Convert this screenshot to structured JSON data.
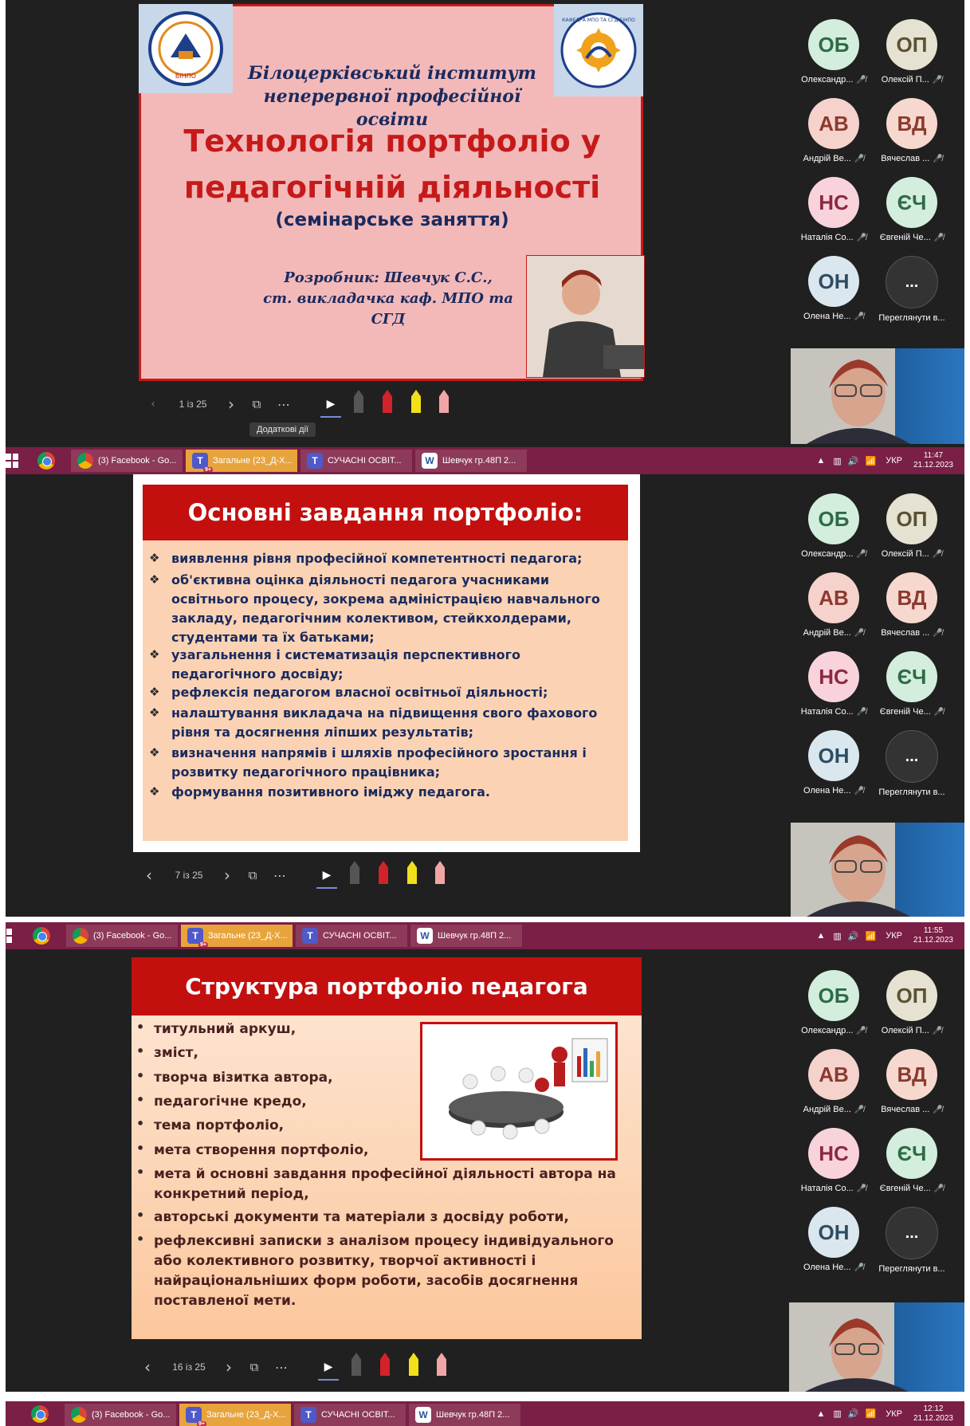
{
  "screens": [
    {
      "slide": {
        "institute": "Білоцерківський інститут\nнеперервної професійної освіти",
        "title": "Технологія  портфоліо у\nпедагогічній діяльності",
        "subtitle": "(семінарське заняття)",
        "author": "Розробник: Шевчук С.С.,\nст. викладачка каф. МПО та СГД",
        "logo_left_text": "БІНПО",
        "logo_right_text": "КАФЕДРА МПО ТА СГД БІНПО"
      },
      "controls": {
        "page": "1 із 25",
        "tooltip": "Додаткові дії"
      },
      "tray": {
        "lang": "УКР",
        "time": "11:47",
        "date": "21.12.2023"
      }
    },
    {
      "slide": {
        "title": "Основні завдання  портфоліо:",
        "items": [
          "виявлення рівня професійної компетентності педагога;",
          "об'єктивна оцінка діяльності педагога учасниками освітнього процесу, зокрема адміністрацією навчального закладу, педагогічним колективом, стейкхолдерами, студентами та їх батьками;",
          "узагальнення і систематизація перспективного педагогічного досвіду;",
          "рефлексія педагогом власної освітньої діяльності;",
          "налаштування викладача на підвищення свого фахового рівня та досягнення ліпших результатів;",
          "визначення напрямів і шляхів професійного зростання і розвитку педагогічного працівника;",
          "формування позитивного іміджу педагога."
        ]
      },
      "controls": {
        "page": "7 із 25"
      },
      "tray": {
        "lang": "УКР",
        "time": "11:55",
        "date": "21.12.2023"
      }
    },
    {
      "slide": {
        "title": "Структура портфоліо педагога",
        "items": [
          "титульний аркуш,",
          "зміст,",
          "творча візитка автора,",
          "педагогічне кредо,",
          "тема портфоліо,",
          "мета створення портфоліо,",
          "мета й основні завдання професійної діяльності автора на конкретний період,",
          "авторські документи та матеріали з досвіду роботи,",
          "рефлексивні записки з аналізом процесу індивідуального або колективного розвитку, творчої активності і найраціональніших форм роботи, засобів досягнення поставленої мети."
        ]
      },
      "controls": {
        "page": "16 із 25"
      },
      "tray": {
        "lang": "УКР",
        "time": "12:12",
        "date": "21.12.2023"
      }
    }
  ],
  "participants": [
    {
      "initials": "ОБ",
      "name": "Олександр...",
      "bg": "#d3eedd",
      "fg": "#2e6b46"
    },
    {
      "initials": "ОП",
      "name": "Олексій П...",
      "bg": "#e6e2d1",
      "fg": "#5b5233"
    },
    {
      "initials": "АВ",
      "name": "Андрій Ве...",
      "bg": "#f6d2cd",
      "fg": "#8a3b2f"
    },
    {
      "initials": "ВД",
      "name": "Вячеслав ...",
      "bg": "#f7d8cf",
      "fg": "#8a3b2f"
    },
    {
      "initials": "НС",
      "name": "Наталія Со...",
      "bg": "#f9d3dc",
      "fg": "#8c2943"
    },
    {
      "initials": "ЄЧ",
      "name": "Євгеній Че...",
      "bg": "#d3eedd",
      "fg": "#2e6b46"
    },
    {
      "initials": "ОН",
      "name": "Олена Не...",
      "bg": "#dbe7ee",
      "fg": "#2e4d63"
    },
    {
      "initials": "...",
      "name": "Переглянути в...",
      "bg": "#333333",
      "fg": "#ffffff"
    }
  ],
  "taskbar": {
    "items": [
      {
        "label": "(3) Facebook - Go..."
      },
      {
        "label": "Загальне (23_Д-Х...",
        "badge": "9+"
      },
      {
        "label": "СУЧАСНІ ОСВІТ..."
      },
      {
        "label": "Шевчук гр.48П 2..."
      }
    ]
  },
  "colors": {
    "slide_red": "#c61a1a",
    "slide1_bg": "#f3b9b9",
    "slide_peach": "#fbd3b4",
    "navy_text": "#1a2a5e",
    "taskbar": "#7a1f45"
  }
}
